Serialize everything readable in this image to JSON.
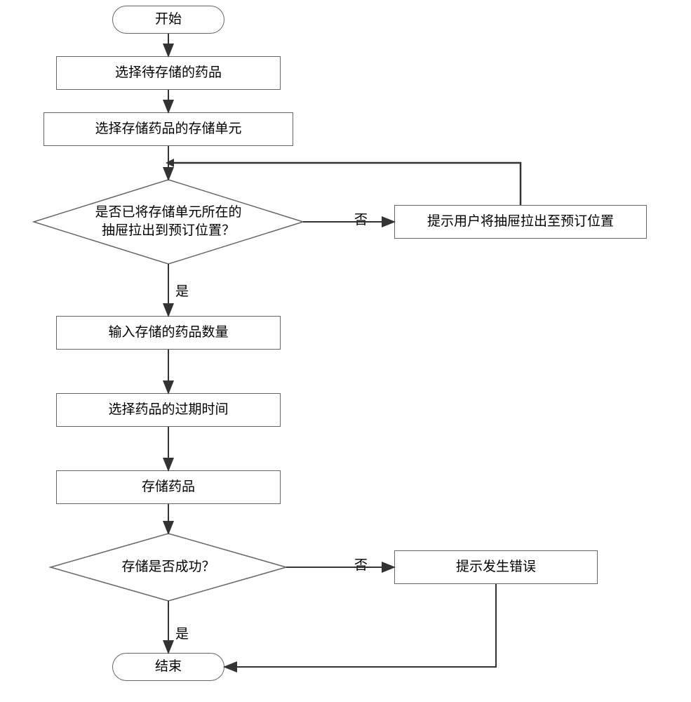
{
  "chart_data": {
    "type": "flowchart",
    "nodes": [
      {
        "id": "start",
        "shape": "terminator",
        "text": "开始"
      },
      {
        "id": "p1",
        "shape": "process",
        "text": "选择待存储的药品"
      },
      {
        "id": "p2",
        "shape": "process",
        "text": "选择存储药品的存储单元"
      },
      {
        "id": "d1",
        "shape": "decision",
        "text": "是否已将存储单元所在的\n抽屉拉出到预订位置？"
      },
      {
        "id": "p3",
        "shape": "process",
        "text": "提示用户将抽屉拉出至预订位置"
      },
      {
        "id": "p4",
        "shape": "process",
        "text": "输入存储的药品数量"
      },
      {
        "id": "p5",
        "shape": "process",
        "text": "选择药品的过期时间"
      },
      {
        "id": "p6",
        "shape": "process",
        "text": "存储药品"
      },
      {
        "id": "d2",
        "shape": "decision",
        "text": "存储是否成功？"
      },
      {
        "id": "p7",
        "shape": "process",
        "text": "提示发生错误"
      },
      {
        "id": "end",
        "shape": "terminator",
        "text": "结束"
      }
    ],
    "edges": [
      {
        "from": "start",
        "to": "p1"
      },
      {
        "from": "p1",
        "to": "p2"
      },
      {
        "from": "p2",
        "to": "d1"
      },
      {
        "from": "d1",
        "to": "p4",
        "label": "是"
      },
      {
        "from": "d1",
        "to": "p3",
        "label": "否"
      },
      {
        "from": "p3",
        "to": "d1",
        "feedback": true
      },
      {
        "from": "p4",
        "to": "p5"
      },
      {
        "from": "p5",
        "to": "p6"
      },
      {
        "from": "p6",
        "to": "d2"
      },
      {
        "from": "d2",
        "to": "end",
        "label": "是"
      },
      {
        "from": "d2",
        "to": "p7",
        "label": "否"
      },
      {
        "from": "p7",
        "to": "end"
      }
    ],
    "labels": {
      "yes": "是",
      "no": "否"
    }
  }
}
